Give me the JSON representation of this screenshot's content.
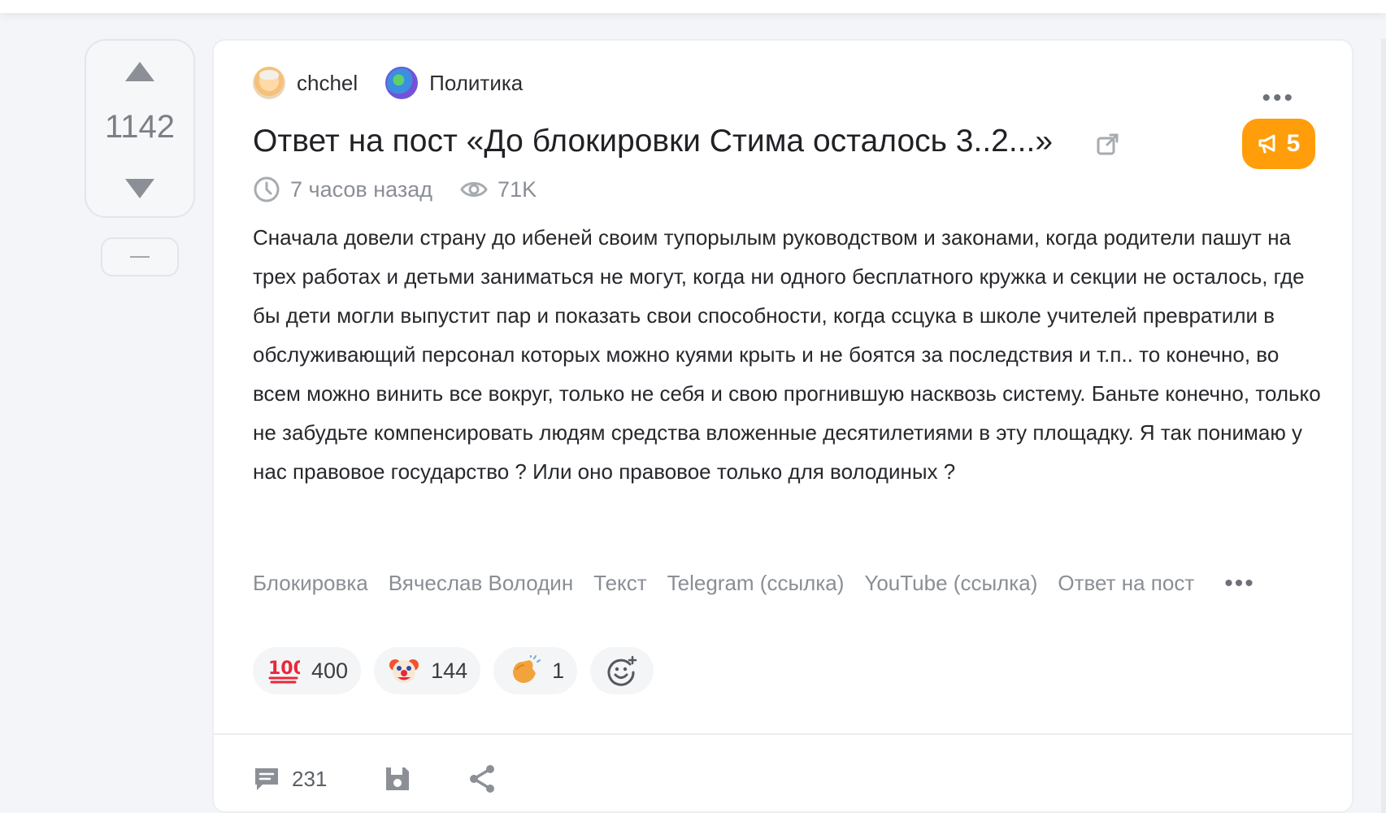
{
  "vote": {
    "count": "1142"
  },
  "post": {
    "author": "chchel",
    "community": "Политика",
    "title": "Ответ на пост «До блокировки Стима осталось 3..2...»",
    "time": "7 часов назад",
    "views": "71K",
    "badge_count": "5",
    "body": "Сначала довели страну до ибеней своим тупорылым руководством и законами, когда родители пашут на трех работах и детьми заниматься не могут, когда ни одного бесплатного кружка и секции не осталось, где бы дети могли выпустит пар и показать свои способности, когда ссцука в школе учителей превратили в обслуживающий персонал которых можно куями крыть и не боятся за последствия и т.п.. то конечно, во всем можно винить все вокруг, только не себя и свою прогнившую насквозь систему. Баньте конечно, только не забудьте компенсировать людям средства вложенные десятилетиями в эту площадку. Я так понимаю у нас правовое государство ? Или оно правовое только для володиных ?",
    "tags": [
      "Блокировка",
      "Вячеслав Володин",
      "Текст",
      "Telegram (ссылка)",
      "YouTube (ссылка)",
      "Ответ на пост"
    ],
    "reactions": [
      {
        "icon": "hundred-points-icon",
        "count": "400"
      },
      {
        "icon": "clown-face-icon",
        "count": "144"
      },
      {
        "icon": "clapping-hands-icon",
        "count": "1"
      }
    ],
    "comments_count": "231"
  },
  "colors": {
    "accent_badge": "#ff9d0a",
    "muted_text": "#8a8e95",
    "body_text": "#26282c"
  }
}
